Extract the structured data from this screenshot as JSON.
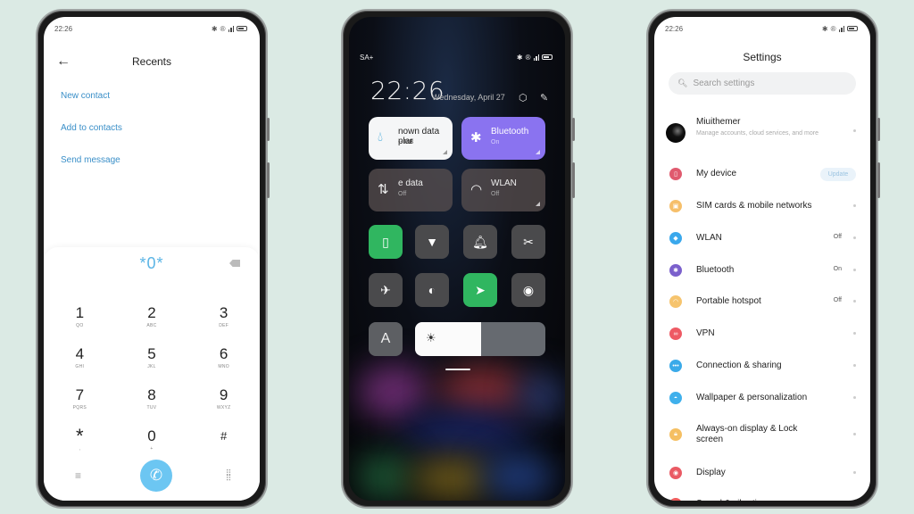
{
  "status_bar": {
    "time": "22:26",
    "carrier": "SA+"
  },
  "dialer": {
    "title": "Recents",
    "links": [
      "New contact",
      "Add to contacts",
      "Send message"
    ],
    "display_number": "*0*",
    "keys": [
      {
        "digit": "1",
        "letters": "QO"
      },
      {
        "digit": "2",
        "letters": "ABC"
      },
      {
        "digit": "3",
        "letters": "DEF"
      },
      {
        "digit": "4",
        "letters": "GHI"
      },
      {
        "digit": "5",
        "letters": "JKL"
      },
      {
        "digit": "6",
        "letters": "MNO"
      },
      {
        "digit": "7",
        "letters": "PQRS"
      },
      {
        "digit": "8",
        "letters": "TUV"
      },
      {
        "digit": "9",
        "letters": "WXYZ"
      },
      {
        "digit": "*",
        "letters": ","
      },
      {
        "digit": "0",
        "letters": "+"
      },
      {
        "digit": "#",
        "letters": ""
      }
    ],
    "accent": "#6cc6f2"
  },
  "control_center": {
    "time": "22:26",
    "date": "Wednesday, April 27",
    "tiles": [
      {
        "title": "nown data plar",
        "subtitle": "-- MB",
        "icon": "water-drop-icon"
      },
      {
        "title": "Bluetooth",
        "subtitle": "On",
        "icon": "bluetooth-icon"
      },
      {
        "title": "e data",
        "subtitle": "Off",
        "icon": "mobile-data-icon"
      },
      {
        "title": "WLAN",
        "subtitle": "Off",
        "icon": "wifi-icon"
      }
    ],
    "toggles": [
      {
        "name": "vibrate",
        "on": true
      },
      {
        "name": "flashlight",
        "on": false
      },
      {
        "name": "ring",
        "on": false
      },
      {
        "name": "screenshot",
        "on": false
      },
      {
        "name": "airplane-mode",
        "on": false
      },
      {
        "name": "dark-mode",
        "on": false
      },
      {
        "name": "location",
        "on": true
      },
      {
        "name": "reading-mode",
        "on": false
      }
    ],
    "auto_brightness_label": "A",
    "brightness_percent": 51,
    "colors": {
      "bluetooth_tile": "#8a73f0",
      "active_toggle": "#30b660"
    }
  },
  "settings": {
    "title": "Settings",
    "search_placeholder": "Search settings",
    "account": {
      "name": "Miuithemer",
      "subtitle": "Manage accounts, cloud services, and more"
    },
    "my_device": {
      "label": "My device",
      "badge": "Update"
    },
    "items": [
      {
        "label": "SIM cards & mobile networks",
        "value": "",
        "color": "#f6bf6a"
      },
      {
        "label": "WLAN",
        "value": "Off",
        "color": "#3aa8ec"
      },
      {
        "label": "Bluetooth",
        "value": "On",
        "color": "#7b60cc"
      },
      {
        "label": "Portable hotspot",
        "value": "Off",
        "color": "#f6c46e"
      },
      {
        "label": "VPN",
        "value": "",
        "color": "#ee5a64"
      },
      {
        "label": "Connection & sharing",
        "value": "",
        "color": "#3aaae9"
      },
      {
        "label": "Wallpaper & personalization",
        "value": "",
        "color": "#3fb0ec"
      },
      {
        "label": "Always-on display & Lock screen",
        "value": "",
        "color": "#f5bf62"
      },
      {
        "label": "Display",
        "value": "",
        "color": "#ea5a64"
      },
      {
        "label": "Sound & vibration",
        "value": "",
        "color": "#ee5a5a"
      }
    ]
  }
}
